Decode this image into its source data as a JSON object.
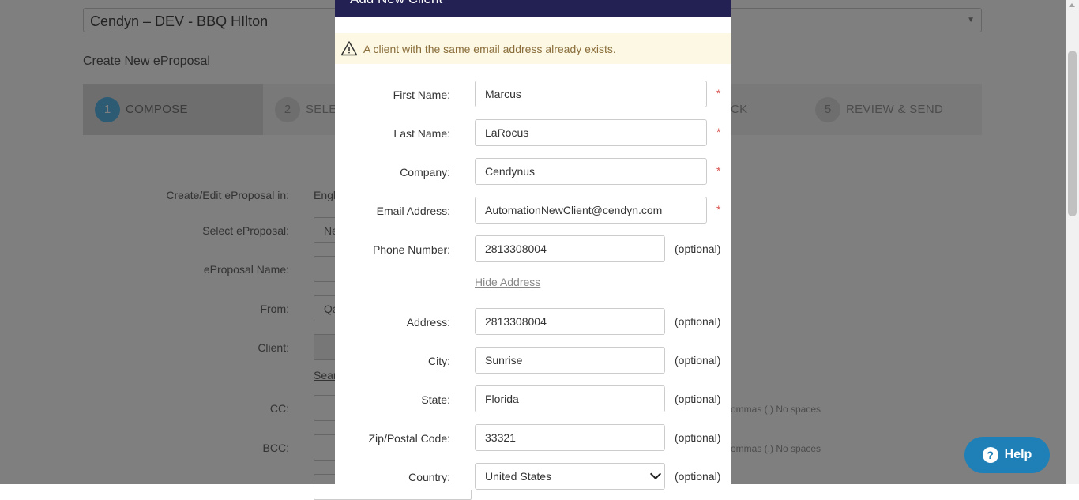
{
  "background": {
    "property": "Cendyn – DEV - BBQ HIlton",
    "page_title": "Create New eProposal",
    "steps": [
      {
        "num": "1",
        "label": "COMPOSE"
      },
      {
        "num": "2",
        "label": "SELE"
      },
      {
        "num": "",
        "label": "CK"
      },
      {
        "num": "5",
        "label": "REVIEW & SEND"
      }
    ],
    "form_labels": {
      "create_in": "Create/Edit eProposal in:",
      "select": "Select eProposal:",
      "name": "eProposal Name:",
      "from": "From:",
      "client": "Client:",
      "cc": "CC:",
      "bcc": "BCC:"
    },
    "create_in_value": "Engl",
    "select_value": "Ne",
    "from_value": "Qa",
    "search_link": "Sear",
    "cc_hint": "or commas (,) No spaces",
    "bcc_hint": "or commas (,) No spaces"
  },
  "modal": {
    "title": "Add New Client",
    "alert": "A client with the same email address already exists.",
    "required_mark": "*",
    "optional_label": "(optional)",
    "hide_address": "Hide Address",
    "fields": {
      "first_name": {
        "label": "First Name:",
        "value": "Marcus"
      },
      "last_name": {
        "label": "Last Name:",
        "value": "LaRocus"
      },
      "company": {
        "label": "Company:",
        "value": "Cendynus"
      },
      "email": {
        "label": "Email Address:",
        "value": "AutomationNewClient@cendyn.com"
      },
      "phone": {
        "label": "Phone Number:",
        "value": "2813308004"
      },
      "address": {
        "label": "Address:",
        "value": "2813308004"
      },
      "city": {
        "label": "City:",
        "value": "Sunrise"
      },
      "state": {
        "label": "State:",
        "value": "Florida"
      },
      "zip": {
        "label": "Zip/Postal Code:",
        "value": "33321"
      },
      "country": {
        "label": "Country:",
        "value": "United States"
      }
    }
  },
  "help": {
    "label": "Help",
    "icon": "?"
  }
}
